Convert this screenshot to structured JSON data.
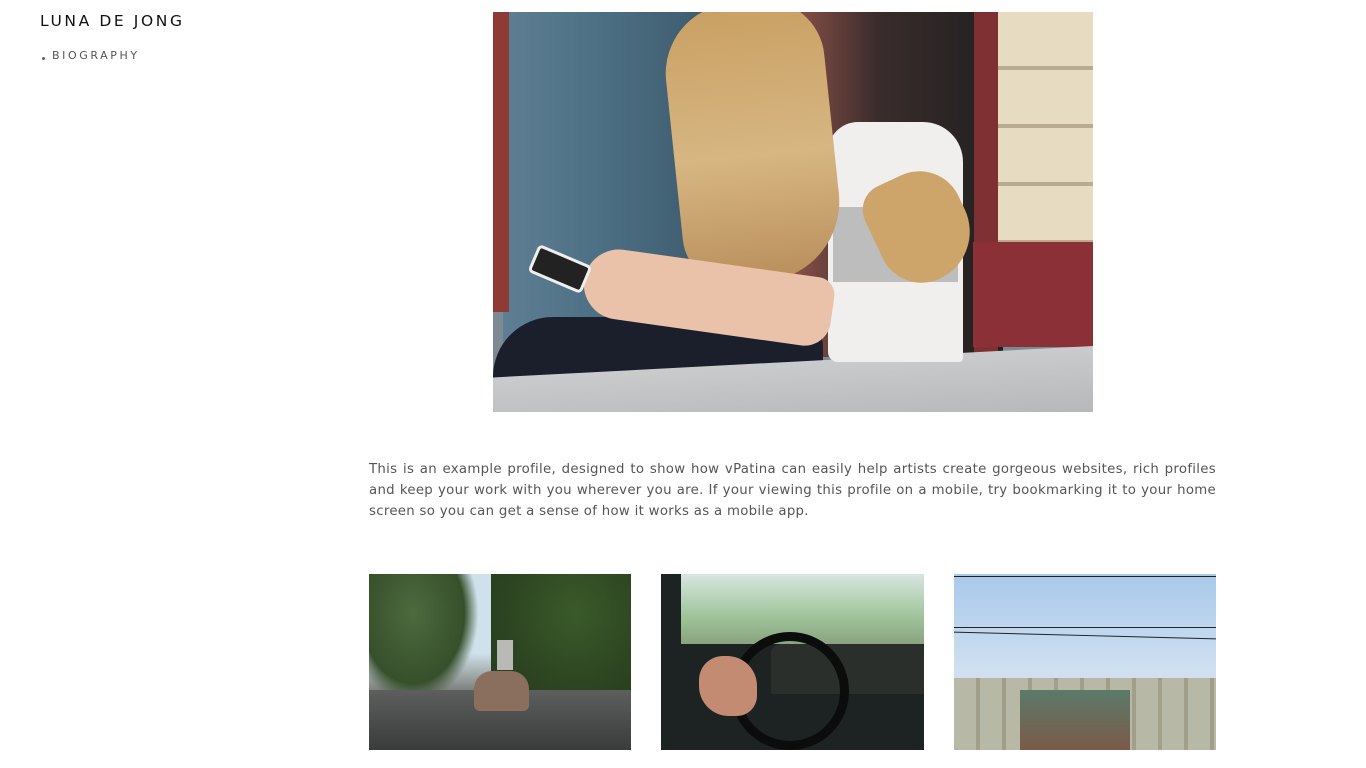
{
  "site": {
    "title": "LUNA DE JONG"
  },
  "nav": {
    "items": [
      {
        "label": "BIOGRAPHY"
      }
    ]
  },
  "main": {
    "bio_text": "This is an example profile, designed to show how vPatina can easily help artists create gorgeous websites, rich profiles and keep your work with you wherever you are. If your viewing this profile on a mobile, try bookmarking it to your home screen so you can get a sense of how it works as a mobile app."
  },
  "colors": {
    "title_text": "#111111",
    "nav_text": "#555555",
    "body_text": "#555555",
    "background": "#ffffff"
  }
}
